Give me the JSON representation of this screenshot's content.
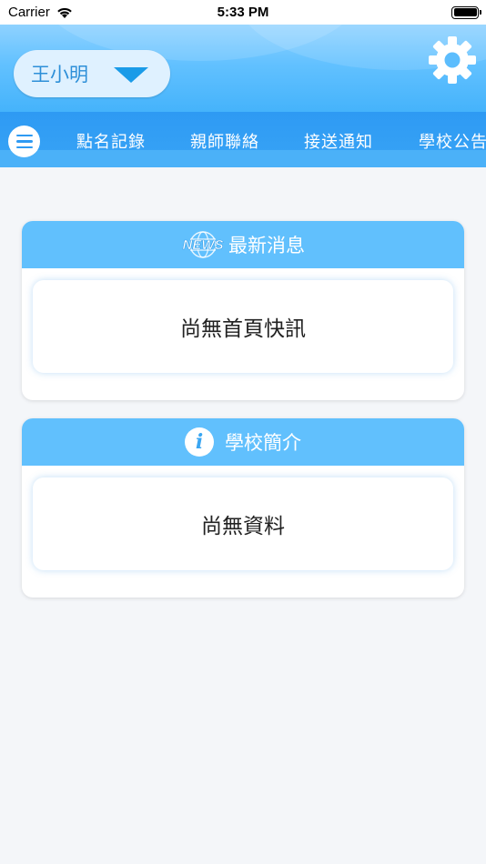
{
  "status_bar": {
    "carrier": "Carrier",
    "time": "5:33 PM"
  },
  "header": {
    "user_name": "王小明"
  },
  "nav": {
    "tabs": [
      {
        "label": "點名記錄"
      },
      {
        "label": "親師聯絡"
      },
      {
        "label": "接送通知"
      },
      {
        "label": "學校公告"
      }
    ]
  },
  "news_card": {
    "icon_text": "NEWS",
    "title": "最新消息",
    "content": "尚無首頁快訊"
  },
  "intro_card": {
    "icon_text": "i",
    "title": "學校簡介",
    "content": "尚無資料"
  },
  "colors": {
    "header_light": "#8fd2ff",
    "header_dark": "#45b3fb",
    "nav_blue": "#2e9af3",
    "card_header": "#61c0fd",
    "background": "#f4f6f9"
  },
  "icons": {
    "wifi": "wifi-icon",
    "battery": "battery-icon",
    "settings": "gear-icon",
    "menu": "hamburger-menu-icon",
    "dropdown": "caret-down-icon",
    "news": "news-globe-icon",
    "info": "info-icon"
  }
}
